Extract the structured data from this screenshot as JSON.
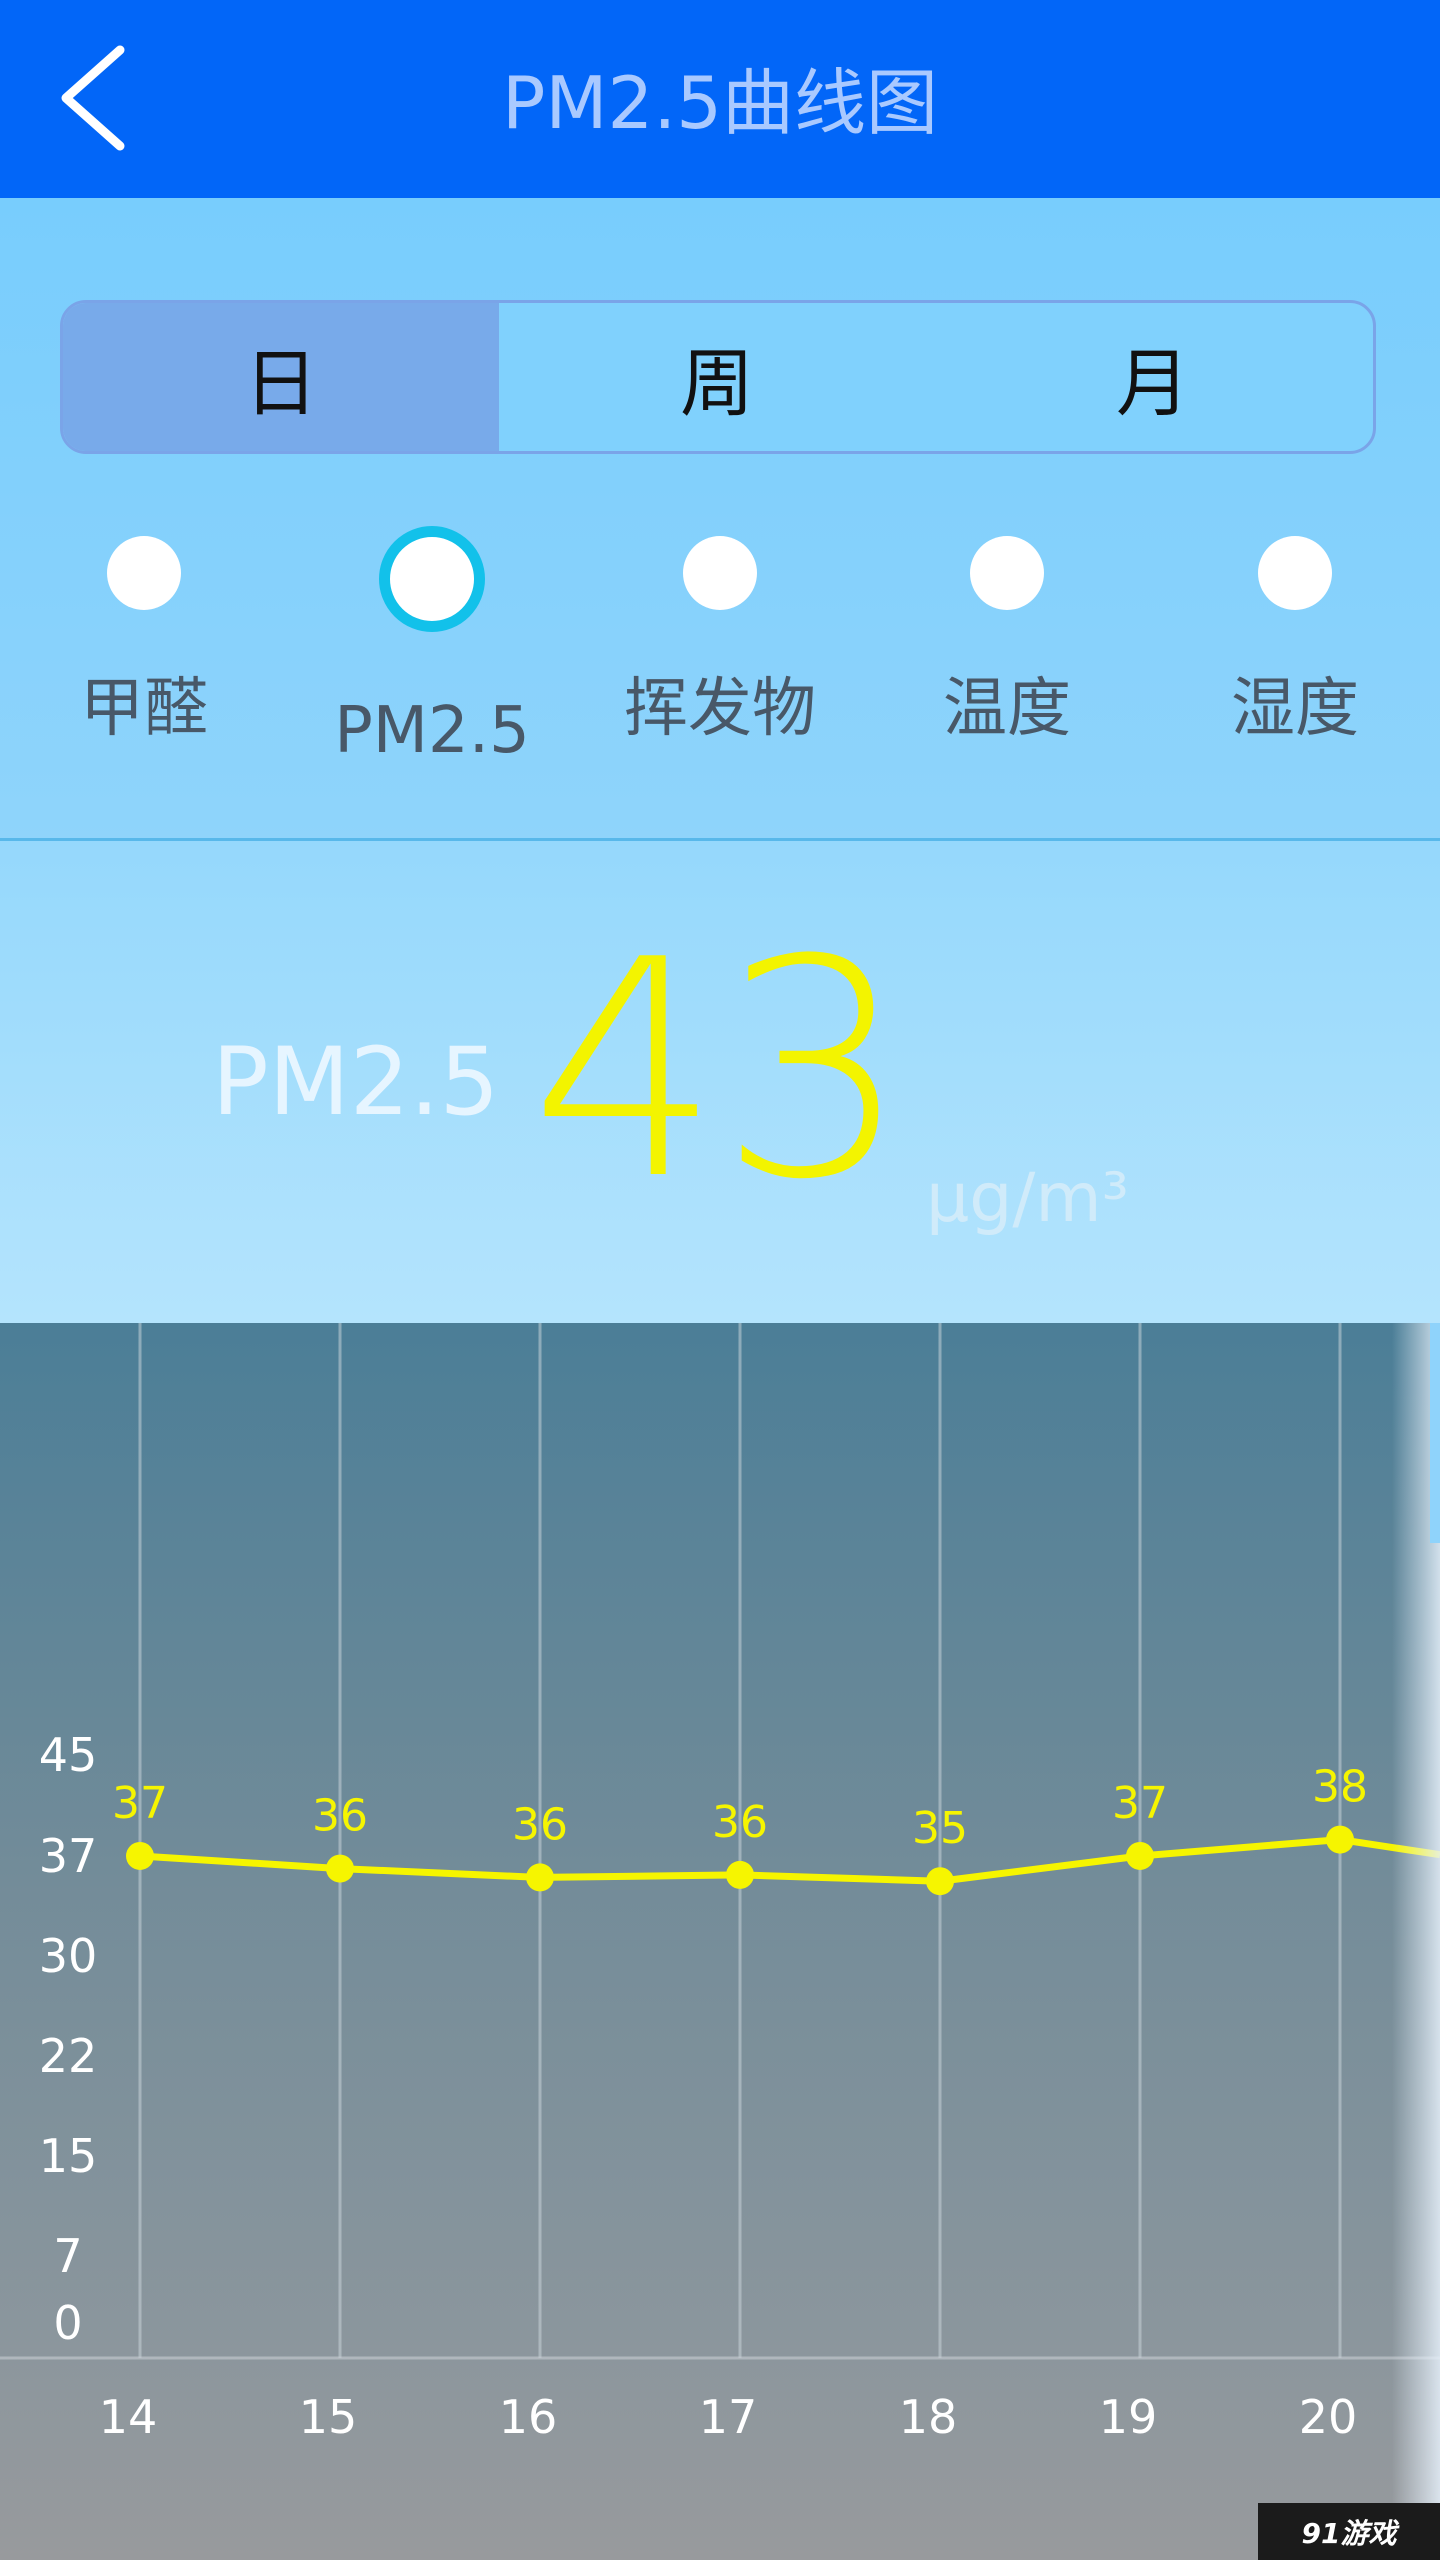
{
  "header": {
    "title": "PM2.5曲线图",
    "back_icon": "chevron-left-icon"
  },
  "tabs": [
    {
      "label": "日",
      "active": true
    },
    {
      "label": "周",
      "active": false
    },
    {
      "label": "月",
      "active": false
    }
  ],
  "metrics": [
    {
      "label": "甲醛",
      "selected": false
    },
    {
      "label": "PM2.5",
      "selected": true
    },
    {
      "label": "挥发物",
      "selected": false
    },
    {
      "label": "温度",
      "selected": false
    },
    {
      "label": "湿度",
      "selected": false
    }
  ],
  "reading": {
    "label": "PM2.5",
    "value": "43",
    "unit": "μg/m³"
  },
  "chart_data": {
    "type": "line",
    "x": [
      "14",
      "15",
      "16",
      "17",
      "18",
      "19",
      "20"
    ],
    "series": [
      {
        "values": [
          37,
          36,
          35.3,
          35.5,
          35,
          37,
          38.3
        ],
        "labels": [
          "37",
          "36",
          "36",
          "36",
          "35",
          "37",
          "38"
        ]
      }
    ],
    "y_ticks": [
      "45",
      "37",
      "30",
      "22",
      "15",
      "7",
      "0"
    ],
    "ylim": [
      0,
      45
    ],
    "grid": "vertical",
    "line_color": "#f6f500",
    "continues_right": true,
    "continuation_value": 37.1
  },
  "watermark": {
    "text": "91游戏"
  }
}
